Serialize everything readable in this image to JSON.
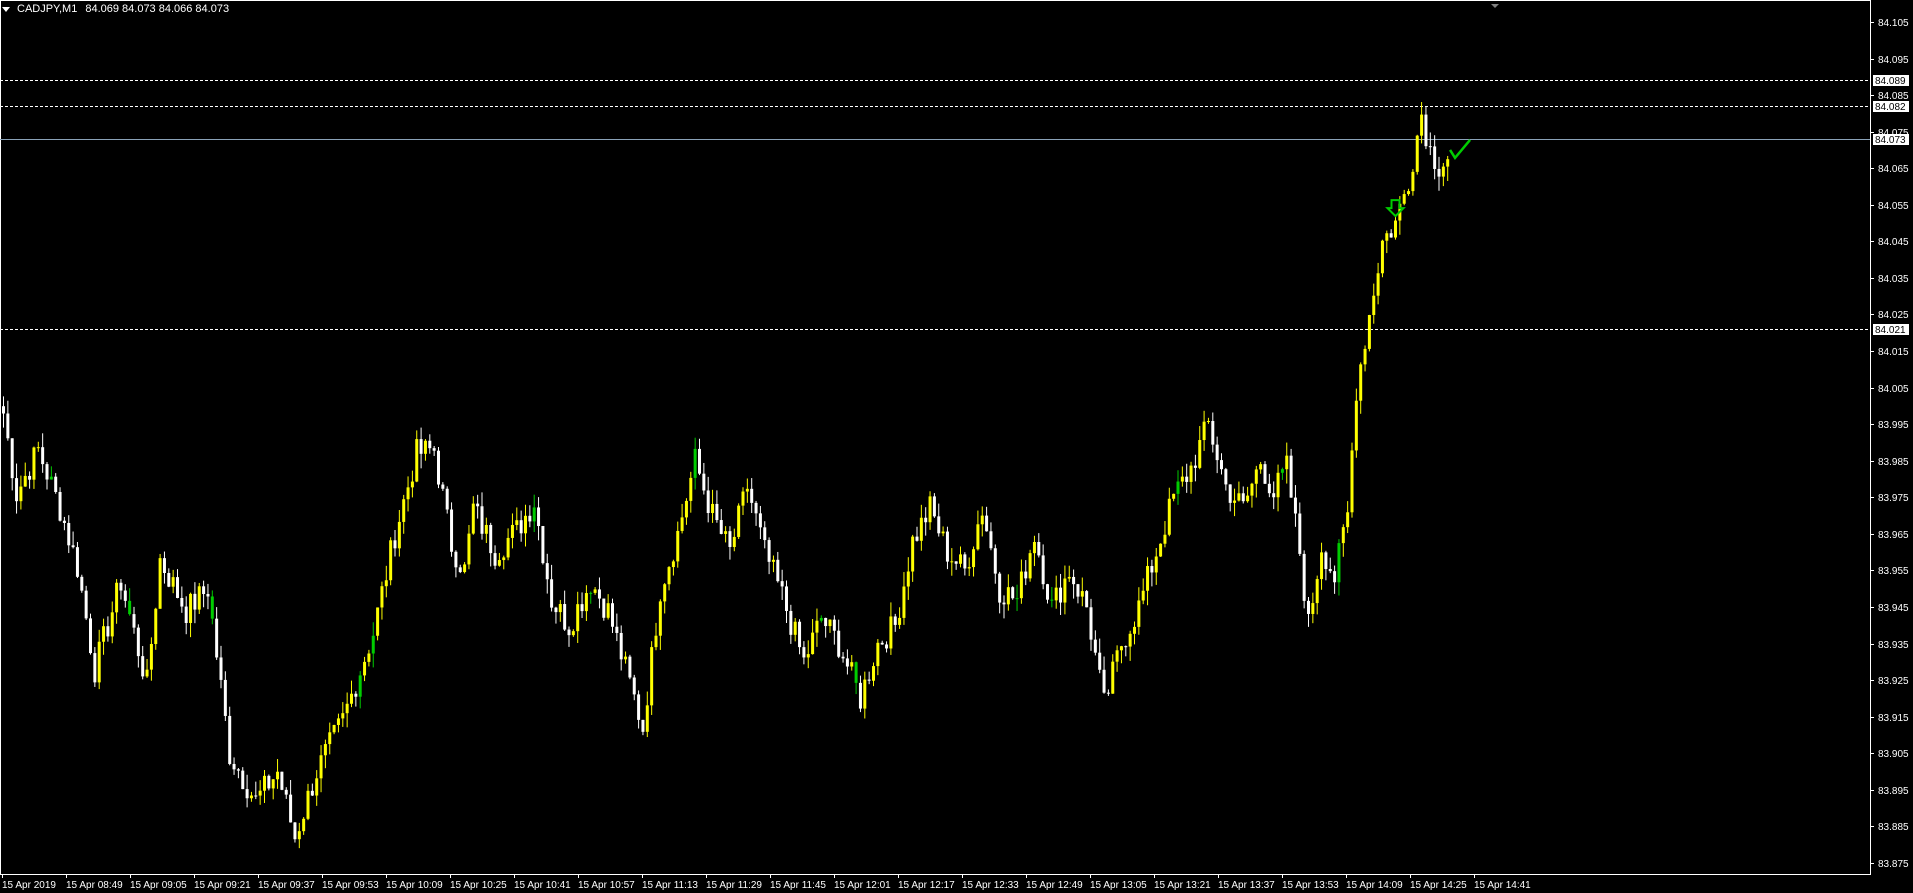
{
  "header": {
    "symbol": "CADJPY,M1",
    "quotes": "84.069 84.073 84.066 84.073"
  },
  "colors": {
    "background": "#000000",
    "bull": "#ffff00",
    "bear": "#ffffff",
    "green": "#00cc00",
    "axis": "#ffffff",
    "bid_line": "#8aa2b8",
    "level_line": "#ffffff"
  },
  "chart_data": {
    "type": "candlestick",
    "symbol": "CADJPY",
    "timeframe": "M1",
    "ylim": [
      83.872,
      84.111
    ],
    "y_ticks": [
      "84.105",
      "84.095",
      "84.085",
      "84.075",
      "84.065",
      "84.055",
      "84.045",
      "84.035",
      "84.025",
      "84.015",
      "84.005",
      "83.995",
      "83.985",
      "83.975",
      "83.965",
      "83.955",
      "83.945",
      "83.935",
      "83.925",
      "83.915",
      "83.905",
      "83.895",
      "83.885",
      "83.875"
    ],
    "x_ticks": [
      "15 Apr 2019",
      "15 Apr 08:49",
      "15 Apr 09:05",
      "15 Apr 09:21",
      "15 Apr 09:37",
      "15 Apr 09:53",
      "15 Apr 10:09",
      "15 Apr 10:25",
      "15 Apr 10:41",
      "15 Apr 10:57",
      "15 Apr 11:13",
      "15 Apr 11:29",
      "15 Apr 11:45",
      "15 Apr 12:01",
      "15 Apr 12:17",
      "15 Apr 12:33",
      "15 Apr 12:49",
      "15 Apr 13:05",
      "15 Apr 13:21",
      "15 Apr 13:37",
      "15 Apr 13:53",
      "15 Apr 14:09",
      "15 Apr 14:25",
      "15 Apr 14:41"
    ],
    "levels": [
      {
        "label": "84.089",
        "value": 84.089,
        "style": "dashed"
      },
      {
        "label": "84.082",
        "value": 84.082,
        "style": "dashed"
      },
      {
        "label": "84.073",
        "value": 84.073,
        "style": "solid"
      },
      {
        "label": "84.021",
        "value": 84.021,
        "style": "dashed"
      }
    ],
    "anchors": [
      {
        "i": 0,
        "v": 83.998
      },
      {
        "i": 3,
        "v": 83.976
      },
      {
        "i": 8,
        "v": 83.988
      },
      {
        "i": 13,
        "v": 83.972
      },
      {
        "i": 17,
        "v": 83.956
      },
      {
        "i": 21,
        "v": 83.928
      },
      {
        "i": 27,
        "v": 83.952
      },
      {
        "i": 33,
        "v": 83.924
      },
      {
        "i": 36,
        "v": 83.958
      },
      {
        "i": 42,
        "v": 83.944
      },
      {
        "i": 47,
        "v": 83.95
      },
      {
        "i": 52,
        "v": 83.905
      },
      {
        "i": 58,
        "v": 83.892
      },
      {
        "i": 63,
        "v": 83.9
      },
      {
        "i": 67,
        "v": 83.882
      },
      {
        "i": 72,
        "v": 83.9
      },
      {
        "i": 78,
        "v": 83.914
      },
      {
        "i": 85,
        "v": 83.938
      },
      {
        "i": 90,
        "v": 83.965
      },
      {
        "i": 95,
        "v": 83.987
      },
      {
        "i": 99,
        "v": 83.988
      },
      {
        "i": 103,
        "v": 83.962
      },
      {
        "i": 106,
        "v": 83.955
      },
      {
        "i": 108,
        "v": 83.972
      },
      {
        "i": 113,
        "v": 83.96
      },
      {
        "i": 118,
        "v": 83.966
      },
      {
        "i": 122,
        "v": 83.974
      },
      {
        "i": 126,
        "v": 83.947
      },
      {
        "i": 130,
        "v": 83.94
      },
      {
        "i": 135,
        "v": 83.952
      },
      {
        "i": 139,
        "v": 83.944
      },
      {
        "i": 143,
        "v": 83.928
      },
      {
        "i": 147,
        "v": 83.912
      },
      {
        "i": 151,
        "v": 83.95
      },
      {
        "i": 155,
        "v": 83.965
      },
      {
        "i": 159,
        "v": 83.985
      },
      {
        "i": 163,
        "v": 83.97
      },
      {
        "i": 167,
        "v": 83.96
      },
      {
        "i": 171,
        "v": 83.978
      },
      {
        "i": 175,
        "v": 83.96
      },
      {
        "i": 179,
        "v": 83.948
      },
      {
        "i": 184,
        "v": 83.93
      },
      {
        "i": 188,
        "v": 83.942
      },
      {
        "i": 192,
        "v": 83.935
      },
      {
        "i": 197,
        "v": 83.92
      },
      {
        "i": 201,
        "v": 83.935
      },
      {
        "i": 205,
        "v": 83.94
      },
      {
        "i": 209,
        "v": 83.963
      },
      {
        "i": 213,
        "v": 83.972
      },
      {
        "i": 217,
        "v": 83.96
      },
      {
        "i": 221,
        "v": 83.955
      },
      {
        "i": 225,
        "v": 83.972
      },
      {
        "i": 229,
        "v": 83.95
      },
      {
        "i": 233,
        "v": 83.947
      },
      {
        "i": 237,
        "v": 83.965
      },
      {
        "i": 241,
        "v": 83.945
      },
      {
        "i": 245,
        "v": 83.955
      },
      {
        "i": 249,
        "v": 83.945
      },
      {
        "i": 253,
        "v": 83.918
      },
      {
        "i": 257,
        "v": 83.935
      },
      {
        "i": 261,
        "v": 83.945
      },
      {
        "i": 265,
        "v": 83.96
      },
      {
        "i": 269,
        "v": 83.975
      },
      {
        "i": 273,
        "v": 83.983
      },
      {
        "i": 277,
        "v": 83.995
      },
      {
        "i": 281,
        "v": 83.978
      },
      {
        "i": 285,
        "v": 83.972
      },
      {
        "i": 289,
        "v": 83.985
      },
      {
        "i": 292,
        "v": 83.976
      },
      {
        "i": 295,
        "v": 83.983
      },
      {
        "i": 298,
        "v": 83.96
      },
      {
        "i": 300,
        "v": 83.94
      },
      {
        "i": 303,
        "v": 83.962
      },
      {
        "i": 306,
        "v": 83.953
      },
      {
        "i": 309,
        "v": 83.97
      },
      {
        "i": 311,
        "v": 84.005
      },
      {
        "i": 314,
        "v": 84.025
      },
      {
        "i": 317,
        "v": 84.045
      },
      {
        "i": 320,
        "v": 84.05
      },
      {
        "i": 323,
        "v": 84.062
      },
      {
        "i": 326,
        "v": 84.08
      },
      {
        "i": 328,
        "v": 84.07
      },
      {
        "i": 330,
        "v": 84.066
      },
      {
        "i": 332,
        "v": 84.068
      }
    ],
    "signals": [
      {
        "type": "arrow-down",
        "i": 320,
        "v": 84.053
      },
      {
        "type": "check",
        "i": 333,
        "v": 84.07
      }
    ]
  }
}
